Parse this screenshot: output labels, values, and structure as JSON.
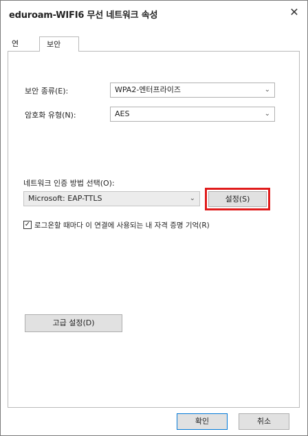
{
  "window": {
    "title": "eduroam-WIFI6 무선 네트워크 속성",
    "close_glyph": "✕"
  },
  "tabs": [
    {
      "label": "연결"
    },
    {
      "label": "보안"
    }
  ],
  "security": {
    "security_type_label": "보안 종류(E):",
    "security_type_value": "WPA2-엔터프라이즈",
    "encryption_type_label": "암호화 유형(N):",
    "encryption_type_value": "AES",
    "auth_method_label": "네트워크 인증 방법 선택(O):",
    "auth_method_value": "Microsoft: EAP-TTLS",
    "settings_button": "설정(S)",
    "remember_credentials_label": "로그온할 때마다 이 연결에 사용되는 내 자격 증명 기억(R)",
    "remember_credentials_checked": true,
    "advanced_button": "고급 설정(D)"
  },
  "footer": {
    "ok_button": "확인",
    "cancel_button": "취소"
  },
  "colors": {
    "highlight": "#e01b1b"
  },
  "icons": {
    "dropdown": "chevron-down-icon",
    "close": "close-icon",
    "check": "check-icon"
  }
}
